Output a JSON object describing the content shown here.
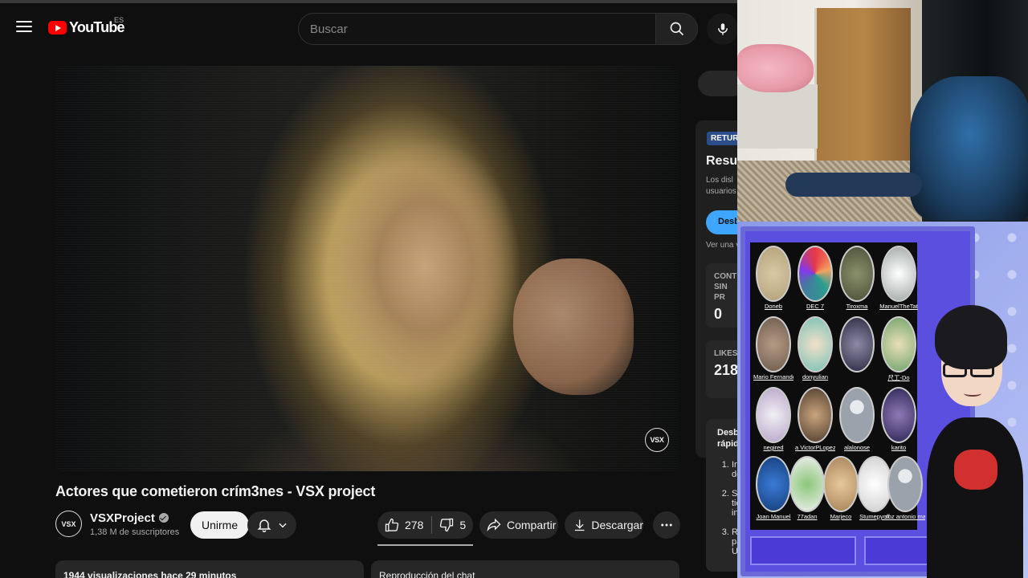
{
  "header": {
    "logo_text": "YouTube",
    "region": "ES",
    "search_placeholder": "Buscar"
  },
  "video": {
    "title": "Actores que cometieron crím3nes - VSX project",
    "watermark": "VSX"
  },
  "channel": {
    "name": "VSXProject",
    "subscribers": "1,38 M de suscriptores",
    "avatar_text": "VSX",
    "join_label": "Unirme"
  },
  "actions": {
    "likes": "278",
    "dislikes": "5",
    "share_label": "Compartir",
    "download_label": "Descargar"
  },
  "description": {
    "meta": "1944 visualizaciones hace 29 minutos"
  },
  "chat": {
    "label": "Reproducción del chat"
  },
  "sidebar": {
    "badge": "RETUR",
    "title": "Resur",
    "desc": "Los disl usuarios",
    "cta": "Desb",
    "link": "Ver una v",
    "stat1_label": "CONTI SIN PR",
    "stat1_value": "0",
    "stat2_label": "LIKES",
    "stat2_value": "218",
    "summary_title": "Desbl rápido",
    "summary_items": [
      "In de",
      "Se tie in",
      "Re pa Ul"
    ]
  },
  "community": {
    "members": [
      {
        "name": "Doneb"
      },
      {
        "name": "DEC 7"
      },
      {
        "name": "Tiroxma"
      },
      {
        "name": "ManuelTheTat"
      },
      {
        "name": "Mario Fernande"
      },
      {
        "name": "donyulian"
      },
      {
        "name": ""
      },
      {
        "name": "尺工-Do"
      },
      {
        "name": "negired"
      },
      {
        "name": "a VictorPLopez"
      },
      {
        "name": "alalonose"
      },
      {
        "name": "karito"
      },
      {
        "name": "Joan Manuel"
      },
      {
        "name": "77adan"
      },
      {
        "name": "Marjeco"
      },
      {
        "name": "Stumepyoff"
      },
      {
        "name": "soz antonio martin"
      }
    ]
  },
  "colors": {
    "brand_red": "#ff0000",
    "accent_blue": "#3ea6ff",
    "community_purple": "#4a3bd6"
  }
}
